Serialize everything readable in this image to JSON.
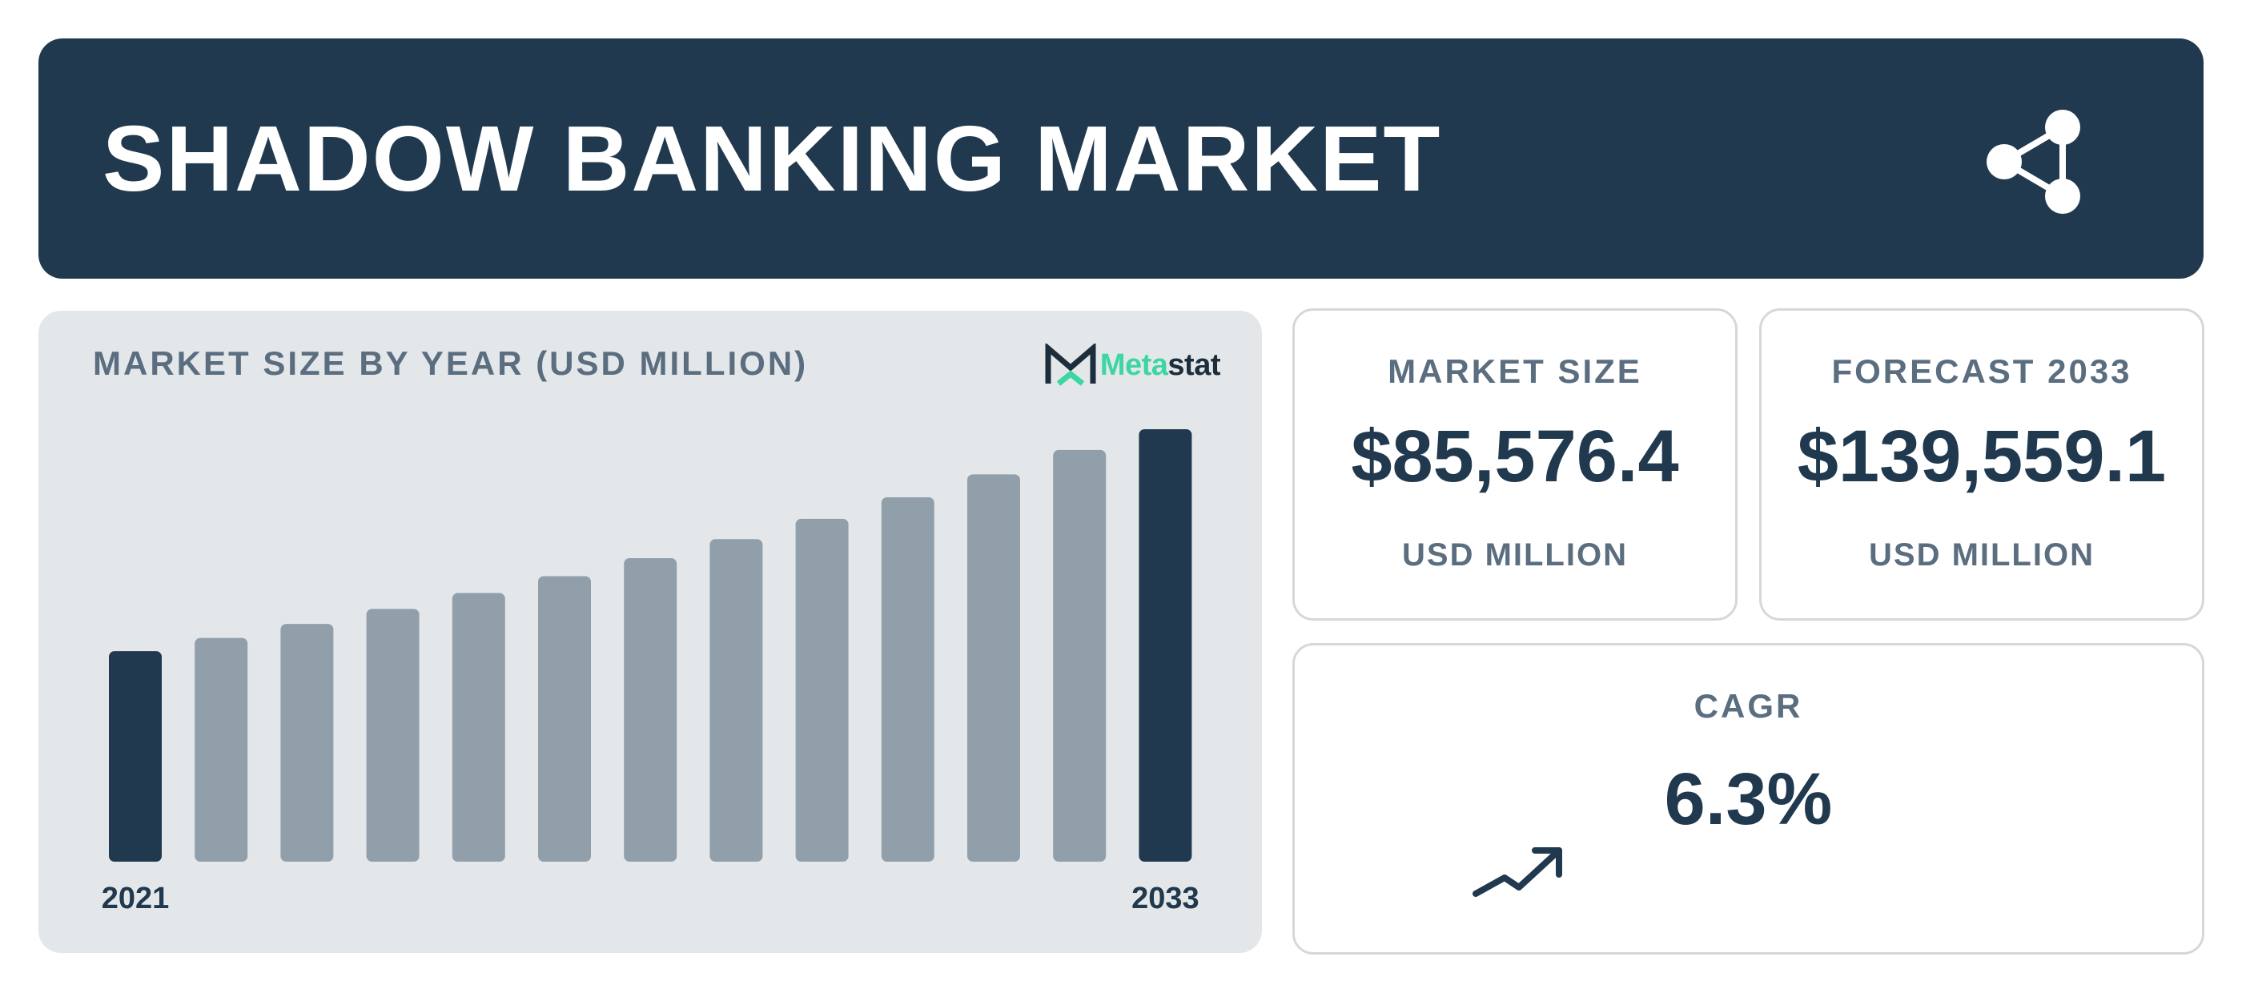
{
  "header": {
    "title": "SHADOW BANKING MARKET",
    "share_icon": "share-icon"
  },
  "chart_panel": {
    "title": "MARKET SIZE BY YEAR (USD MILLION)",
    "logo": {
      "part1": "Meta",
      "part2": "stat"
    }
  },
  "chart_data": {
    "type": "bar",
    "title": "MARKET SIZE BY YEAR (USD MILLION)",
    "x": [
      2021,
      2022,
      2023,
      2024,
      2025,
      2026,
      2027,
      2028,
      2029,
      2030,
      2031,
      2032,
      2033
    ],
    "tick_labels": [
      "2021",
      "",
      "",
      "",
      "",
      "",
      "",
      "",
      "",
      "",
      "",
      "",
      "2033"
    ],
    "values": [
      67927.2,
      72198.9,
      76739.3,
      81565.2,
      86694.7,
      92146.7,
      97941.5,
      104100.7,
      110647.2,
      117605.4,
      125001.1,
      132861.9,
      139559.1
    ],
    "highlight_indices": [
      0,
      12
    ],
    "colors": {
      "highlight": "#21394e",
      "default": "#919fab"
    },
    "ylim": [
      0,
      139559.1
    ],
    "xlabel": "",
    "ylabel": "",
    "grid": false,
    "legend": "none"
  },
  "cards": {
    "market_size": {
      "label": "MARKET SIZE",
      "value": "$85,576.4",
      "unit": "USD MILLION"
    },
    "forecast": {
      "label": "FORECAST 2033",
      "value": "$139,559.1",
      "unit": "USD MILLION"
    },
    "cagr": {
      "label": "CAGR",
      "value": "6.3%",
      "icon": "trend-up-icon"
    }
  },
  "colors": {
    "header_bg": "#21394e",
    "panel_bg": "#e4e7ea",
    "accent_dark": "#21394e",
    "muted_text": "#5b6e80",
    "bar_default": "#919fab",
    "brand_green": "#3dd5a2"
  }
}
